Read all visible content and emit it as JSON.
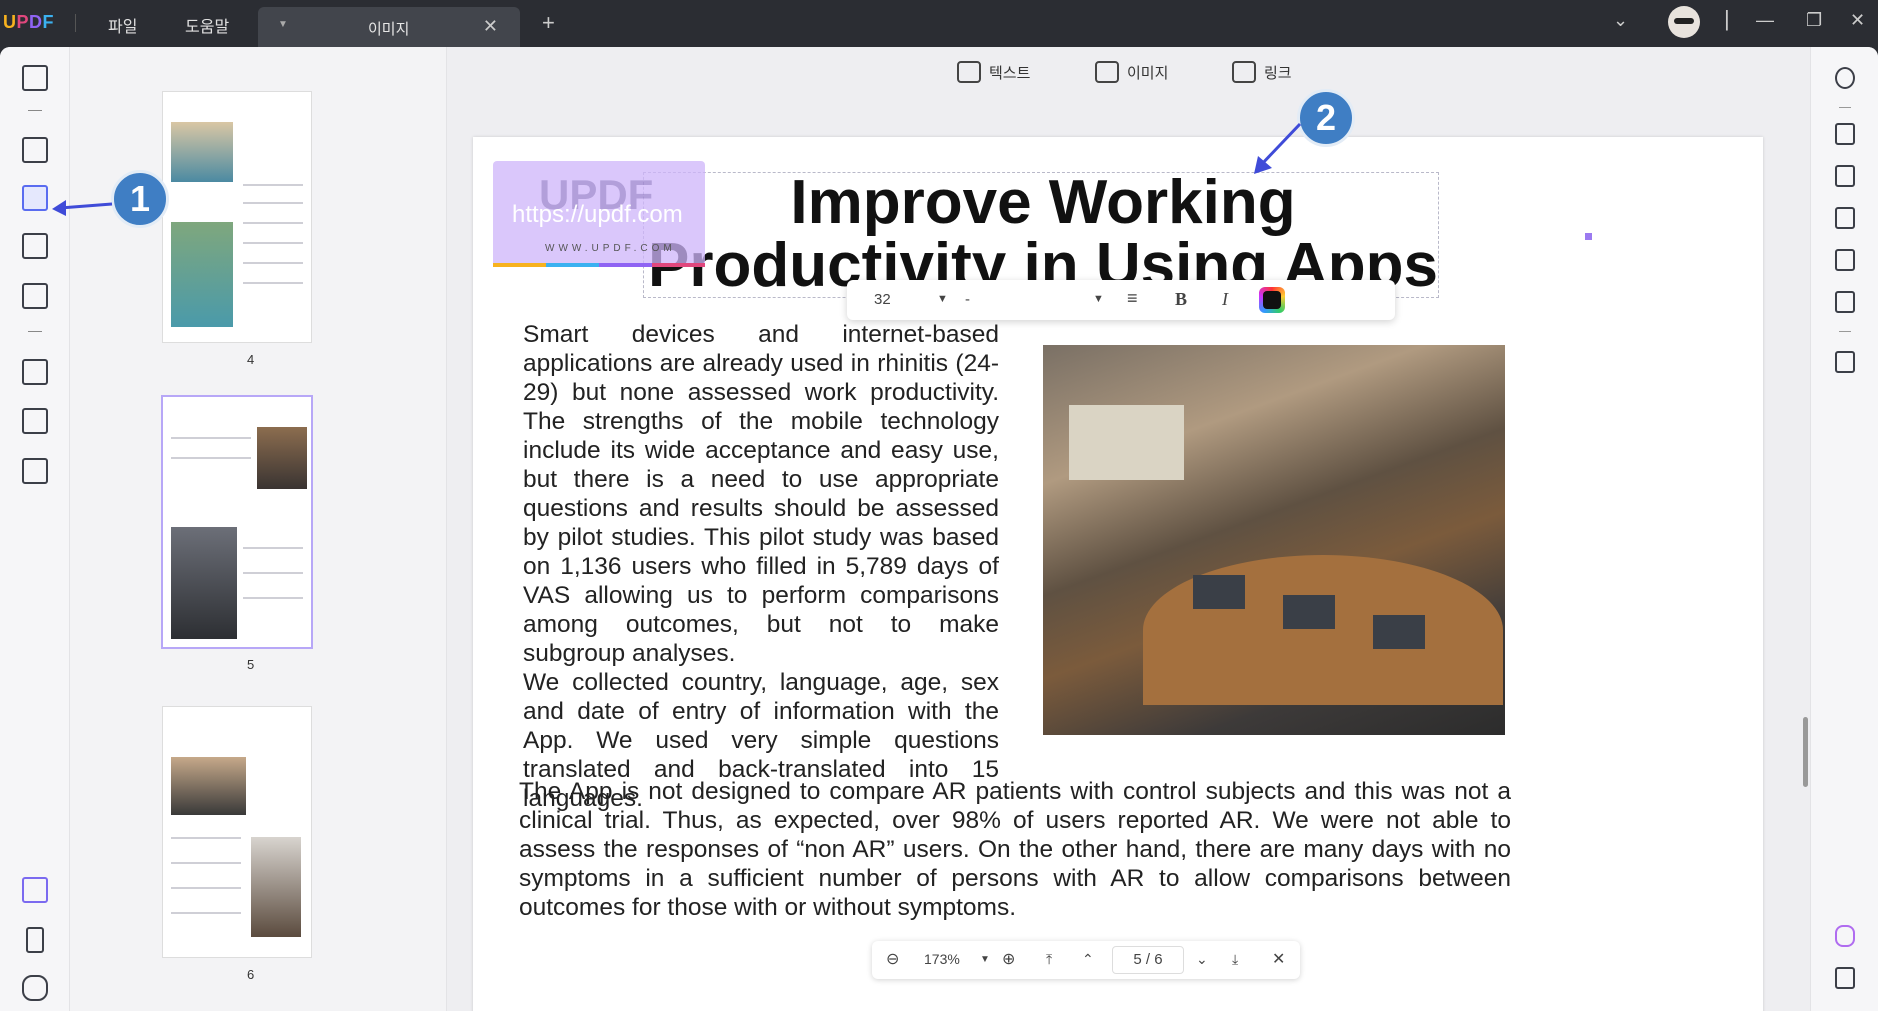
{
  "app": {
    "logo": "UPDF",
    "menu_file": "파일",
    "menu_help": "도움말",
    "tab_title": "이미지",
    "tab_close": "✕",
    "new_tab": "+"
  },
  "edit_toolbar": {
    "text_label": "텍스트",
    "image_label": "이미지",
    "link_label": "링크"
  },
  "thumbnails": [
    {
      "page": "4"
    },
    {
      "page": "5"
    },
    {
      "page": "6"
    }
  ],
  "document": {
    "title": "Improve Working Productivity in Using Apps",
    "paragraph1": "Smart devices and internet-based applications are already used in rhinitis (24-29) but none assessed work productivity. The strengths of the mobile technology include its wide acceptance and easy use, but there is a need to use appropriate questions and results should be assessed by pilot studies. This pilot study was based on 1,136 users who filled in 5,789 days of VAS allowing us to perform comparisons among outcomes, but not to make subgroup analyses.",
    "paragraph2": "We collected country, language, age, sex and date of entry of information with the App. We used very simple questions translated and back-translated into 15 languages.",
    "paragraph3": "The App is not designed to compare AR patients with control subjects and this was not a clinical trial. Thus, as expected, over 98% of users reported AR. We were not able to assess the responses of “non AR” users. On the other hand, there are many days with no symptoms in a sufficient number of persons with AR to allow comparisons between outcomes for those with or without symptoms."
  },
  "watermark": {
    "brand": "UPDF",
    "url": "https://updf.com",
    "sub": "WWW.UPDF.COM"
  },
  "format_bar": {
    "font_size": "32",
    "font_name": "-",
    "bold": "B",
    "italic": "I"
  },
  "zoom_bar": {
    "zoom": "173%",
    "page_indicator": "5 / 6"
  },
  "callouts": {
    "one": "1",
    "two": "2"
  }
}
